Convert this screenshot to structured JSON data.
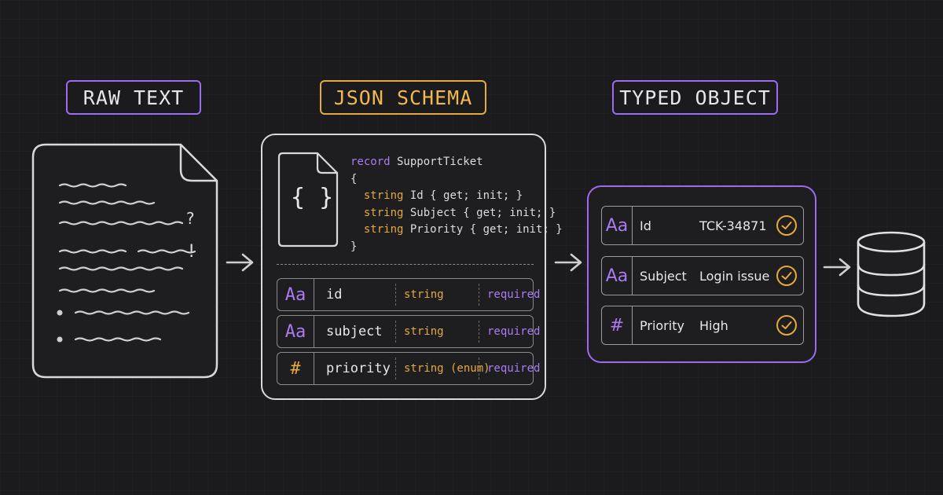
{
  "stages": {
    "raw": {
      "label": "RAW TEXT"
    },
    "schema": {
      "label": "JSON SCHEMA"
    },
    "typed": {
      "label": "TYPED OBJECT"
    }
  },
  "raw_doc": {
    "marks": [
      "?",
      "!"
    ],
    "icon": "document-icon"
  },
  "schema_card": {
    "file_icon_text": "{ }",
    "code": {
      "line1_kw": "record",
      "line1_name": " SupportTicket",
      "open_brace": "{",
      "close_brace": "}",
      "props": [
        {
          "type": "string",
          "rest": " Id { get; init; }"
        },
        {
          "type": "string",
          "rest": " Subject { get; init; }"
        },
        {
          "type": "string",
          "rest": " Priority { get; init; }"
        }
      ]
    },
    "rows": [
      {
        "icon": "Aa",
        "name": "id",
        "type": "string",
        "req": "required"
      },
      {
        "icon": "Aa",
        "name": "subject",
        "type": "string",
        "req": "required"
      },
      {
        "icon": "#",
        "name": "priority",
        "type": "string (enum)",
        "req": "required"
      }
    ]
  },
  "typed_card": {
    "rows": [
      {
        "icon": "Aa",
        "field": "Id",
        "value": "TCK-34871"
      },
      {
        "icon": "Aa",
        "field": "Subject",
        "value": "Login issue"
      },
      {
        "icon": "#",
        "field": "Priority",
        "value": "High"
      }
    ]
  },
  "destination": {
    "icon": "database-icon"
  },
  "colors": {
    "background": "#1b1b1d",
    "purple": "#9b6cf0",
    "yellow": "#e6a93c",
    "stroke": "#d9d9d9"
  }
}
